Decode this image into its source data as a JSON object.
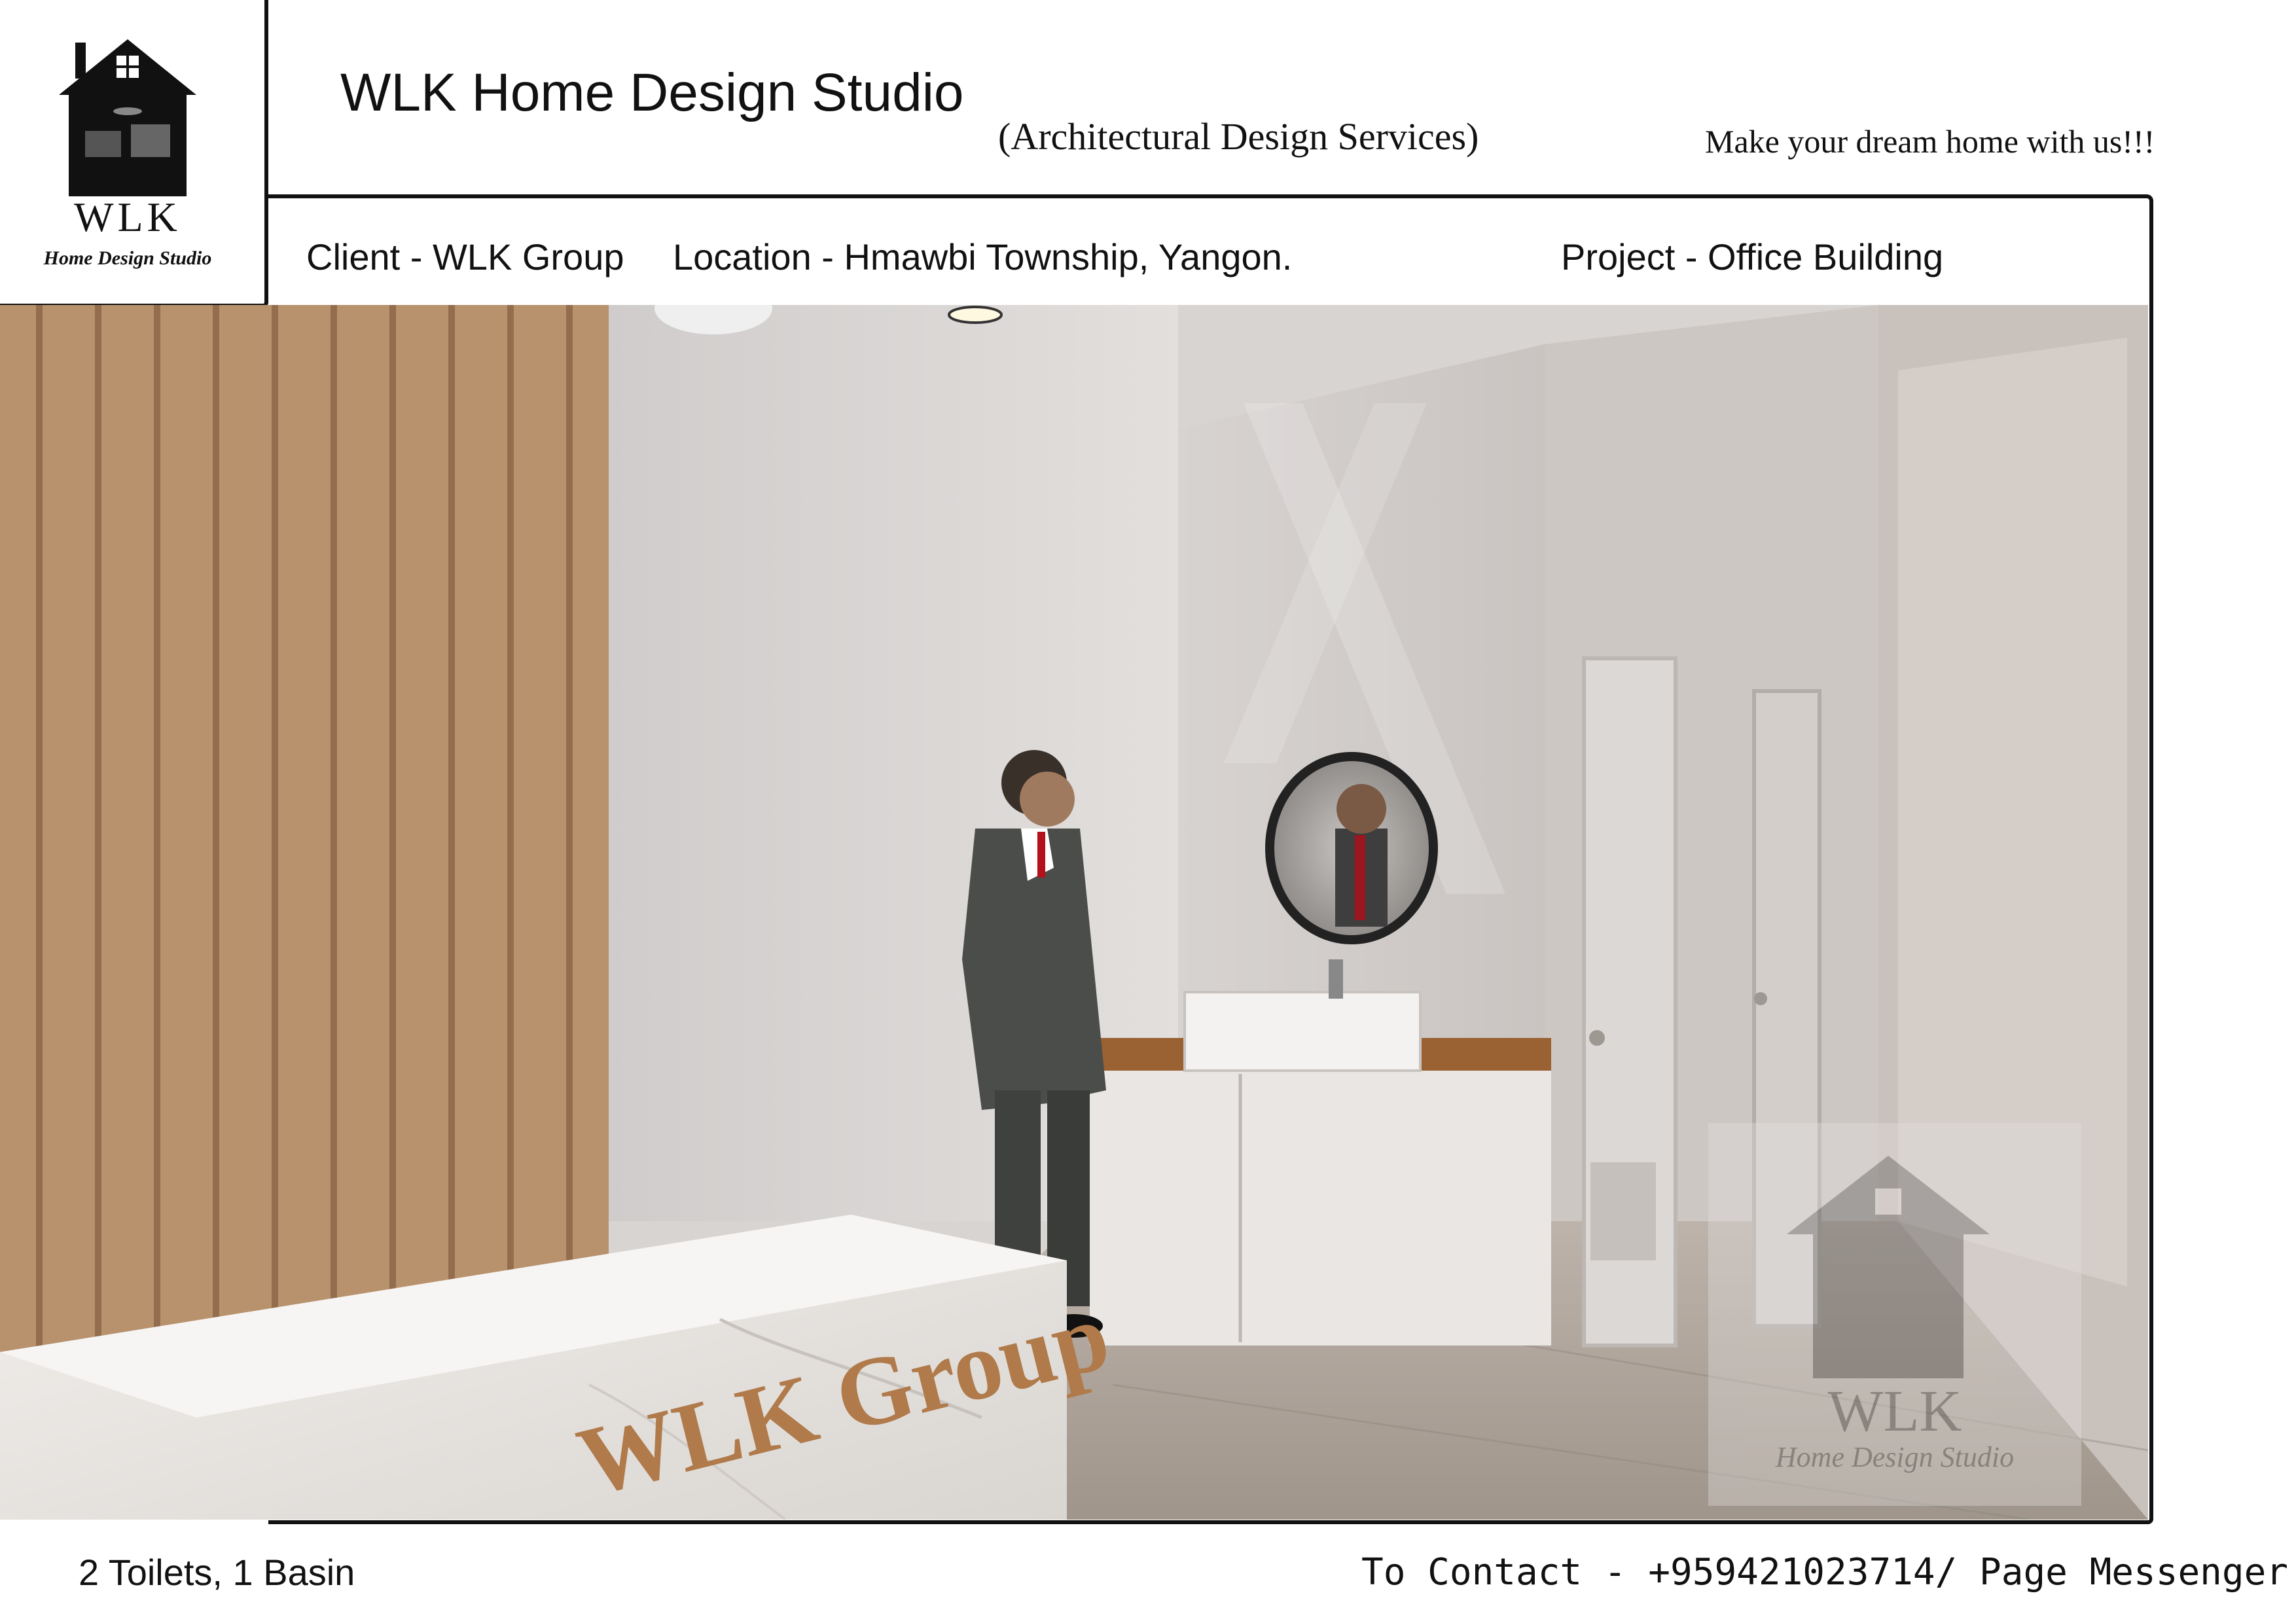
{
  "logo": {
    "letters": "WLK",
    "tagline": "Home Design Studio"
  },
  "header": {
    "title": "WLK Home Design Studio",
    "services": "(Architectural Design Services)",
    "slogan": "Make your dream home with us!!!"
  },
  "info": {
    "client": "Client - WLK Group",
    "location": "Location - Hmawbi Township, Yangon.",
    "project": "Project - Office Building"
  },
  "render": {
    "counter_sign": "WLK Group",
    "watermark": {
      "letters": "WLK",
      "tagline": "Home Design Studio"
    }
  },
  "footer": {
    "spec": "2 Toilets, 1 Basin",
    "contact": "To Contact - +959421023714/ Page Messenger"
  }
}
